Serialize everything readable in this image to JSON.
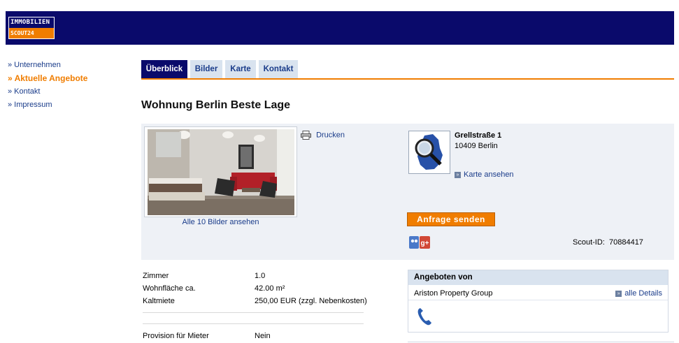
{
  "brand": {
    "line1": "IMMOBILIEN",
    "line2": "SCOUT24"
  },
  "sidebar": {
    "items": [
      {
        "label": "» Unternehmen"
      },
      {
        "label": "» Aktuelle Angebote"
      },
      {
        "label": "» Kontakt"
      },
      {
        "label": "» Impressum"
      }
    ]
  },
  "tabs": [
    {
      "label": "Überblick"
    },
    {
      "label": "Bilder"
    },
    {
      "label": "Karte"
    },
    {
      "label": "Kontakt"
    }
  ],
  "listing": {
    "title": "Wohnung Berlin Beste Lage",
    "photos_link": "Alle 10 Bilder ansehen",
    "print_label": "Drucken",
    "street": "Grellstraße 1",
    "city": "10409 Berlin",
    "map_link": "Karte ansehen",
    "request_button": "Anfrage senden",
    "scout_id_label": "Scout-ID:",
    "scout_id": "70884417"
  },
  "facts": [
    {
      "label": "Zimmer",
      "value": "1.0"
    },
    {
      "label": "Wohnfläche ca.",
      "value": "42.00 m²"
    },
    {
      "label": "Kaltmiete",
      "value": "250,00 EUR (zzgl. Nebenkosten)"
    },
    {
      "label": "Provision für Mieter",
      "value": "Nein"
    }
  ],
  "offered_by": {
    "heading": "Angeboten von",
    "name": "Ariston Property Group",
    "details_link": "alle Details"
  },
  "colors": {
    "navy": "#0a0a6b",
    "orange": "#f07d00",
    "link": "#1a3c8a",
    "panel": "#eef1f6"
  },
  "icons": [
    "print-icon",
    "map-magnifier-icon",
    "arrow-square-icon",
    "social-share-icon",
    "phone-icon"
  ]
}
